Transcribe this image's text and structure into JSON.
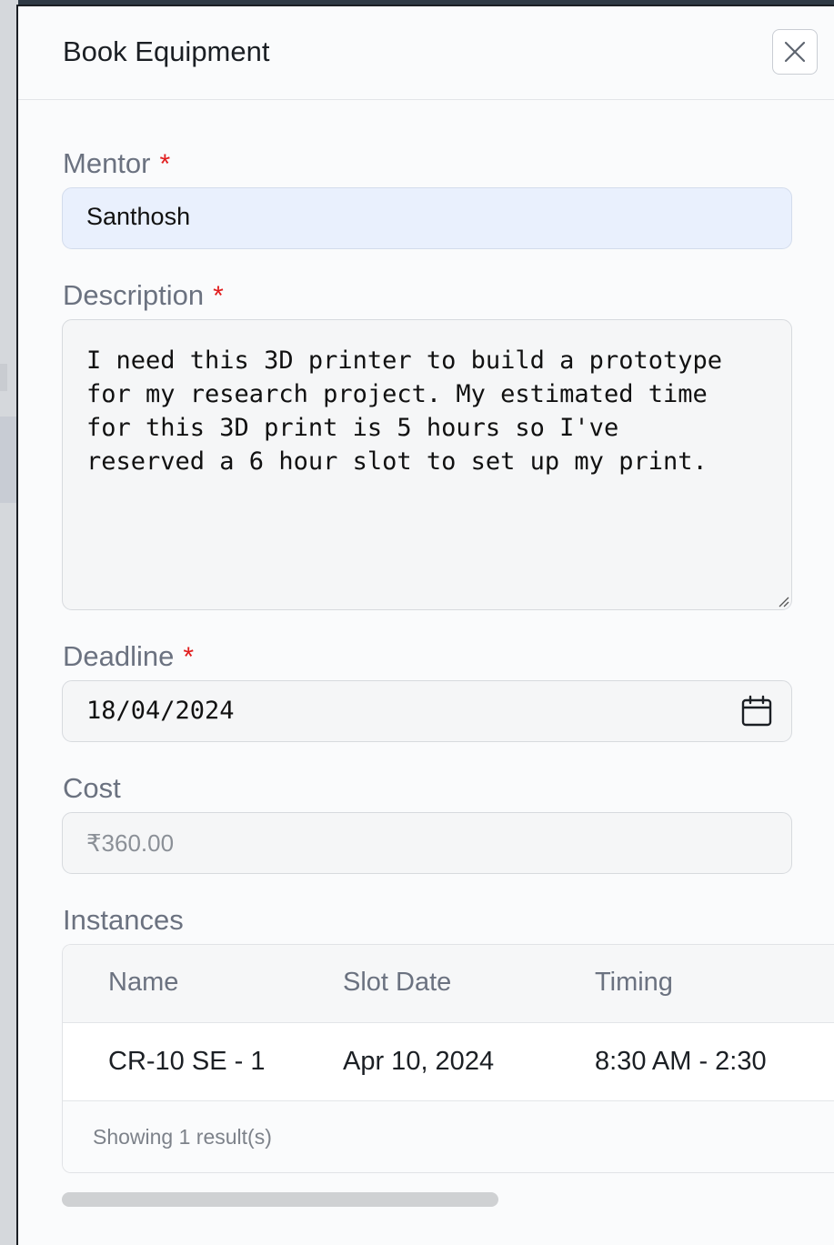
{
  "modal": {
    "title": "Book Equipment"
  },
  "form": {
    "mentor": {
      "label": "Mentor",
      "required_mark": "*",
      "value": "Santhosh"
    },
    "description": {
      "label": "Description",
      "required_mark": "*",
      "value": "I need this 3D printer to build a prototype\nfor my research project. My estimated time\nfor this 3D print is 5 hours so I've\nreserved a 6 hour slot to set up my print."
    },
    "deadline": {
      "label": "Deadline",
      "required_mark": "*",
      "value": "18/04/2024"
    },
    "cost": {
      "label": "Cost",
      "value": "₹360.00"
    }
  },
  "instances": {
    "label": "Instances",
    "columns": [
      "Name",
      "Slot Date",
      "Timing"
    ],
    "rows": [
      [
        "CR-10 SE - 1",
        "Apr 10, 2024",
        "8:30 AM - 2:30"
      ]
    ],
    "footer": "Showing 1 result(s)"
  },
  "icons": {
    "close": "close-icon",
    "calendar": "calendar-icon",
    "resize": "resize-grip-icon"
  },
  "colors": {
    "required": "#e11d1d",
    "mentor_bg": "#e9f0fd",
    "label": "#6b7280"
  }
}
